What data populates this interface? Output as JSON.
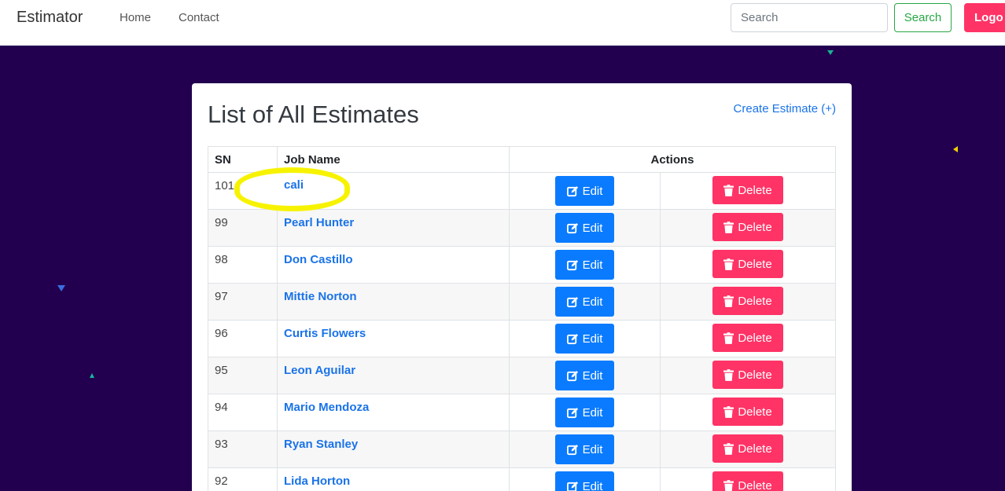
{
  "navbar": {
    "brand": "Estimator",
    "links": [
      "Home",
      "Contact"
    ],
    "search_placeholder": "Search",
    "search_button": "Search",
    "logout_button": "Logo"
  },
  "card": {
    "title": "List of All Estimates",
    "create_link": "Create Estimate (+)"
  },
  "table": {
    "headers": {
      "sn": "SN",
      "job_name": "Job Name",
      "actions": "Actions"
    },
    "edit_label": "Edit",
    "delete_label": "Delete",
    "rows": [
      {
        "sn": "101",
        "job_name": "cali"
      },
      {
        "sn": "99",
        "job_name": "Pearl Hunter"
      },
      {
        "sn": "98",
        "job_name": "Don Castillo"
      },
      {
        "sn": "97",
        "job_name": "Mittie Norton"
      },
      {
        "sn": "96",
        "job_name": "Curtis Flowers"
      },
      {
        "sn": "95",
        "job_name": "Leon Aguilar"
      },
      {
        "sn": "94",
        "job_name": "Mario Mendoza"
      },
      {
        "sn": "93",
        "job_name": "Ryan Stanley"
      },
      {
        "sn": "92",
        "job_name": "Lida Horton"
      }
    ]
  },
  "colors": {
    "background": "#22004f",
    "primary": "#0a7bff",
    "danger": "#ff3366",
    "success": "#28a745",
    "highlight": "#f7f300"
  }
}
